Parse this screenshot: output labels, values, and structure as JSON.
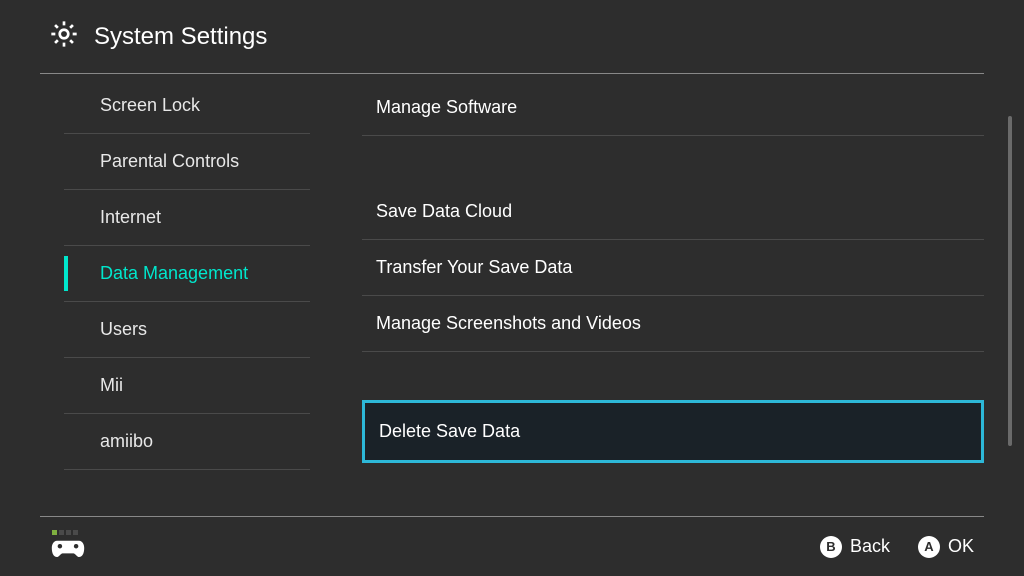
{
  "header": {
    "title": "System Settings"
  },
  "sidebar": {
    "items": [
      {
        "label": "Screen Lock",
        "selected": false
      },
      {
        "label": "Parental Controls",
        "selected": false
      },
      {
        "label": "Internet",
        "selected": false
      },
      {
        "label": "Data Management",
        "selected": true
      },
      {
        "label": "Users",
        "selected": false
      },
      {
        "label": "Mii",
        "selected": false
      },
      {
        "label": "amiibo",
        "selected": false
      }
    ]
  },
  "main": {
    "groups": [
      {
        "items": [
          {
            "label": "Manage Software"
          }
        ]
      },
      {
        "items": [
          {
            "label": "Save Data Cloud"
          },
          {
            "label": "Transfer Your Save Data"
          },
          {
            "label": "Manage Screenshots and Videos"
          }
        ]
      },
      {
        "items": [
          {
            "label": "Delete Save Data",
            "highlighted": true
          }
        ]
      }
    ]
  },
  "footer": {
    "back_glyph": "B",
    "back_label": "Back",
    "ok_glyph": "A",
    "ok_label": "OK"
  },
  "colors": {
    "accent": "#00e6cc",
    "highlight_border": "#2db8d8",
    "background": "#2d2d2d"
  }
}
